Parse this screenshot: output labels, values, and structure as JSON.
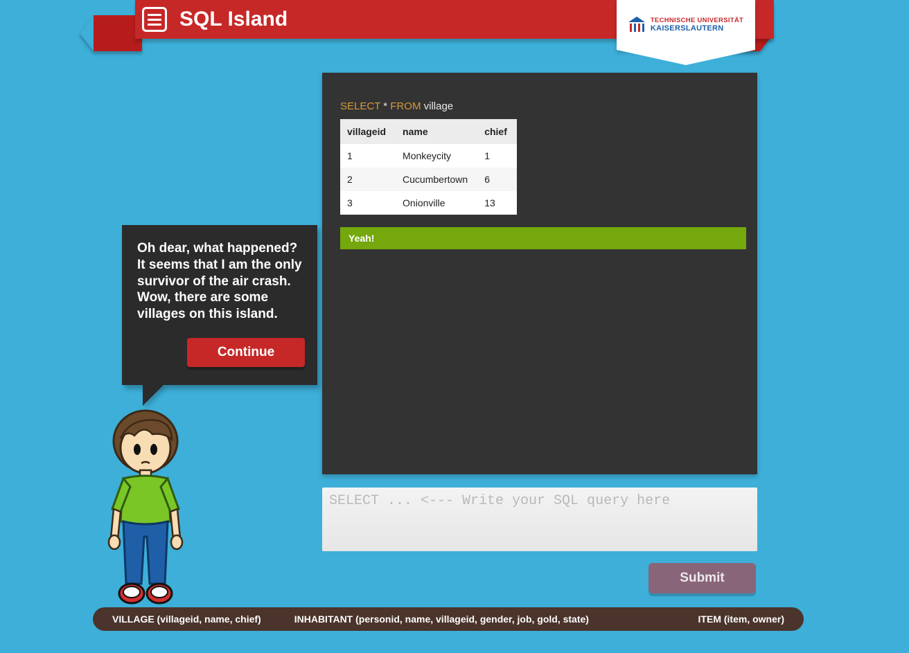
{
  "header": {
    "title": "SQL Island",
    "university_line1": "TECHNISCHE UNIVERSITÄT",
    "university_line2": "KAISERSLAUTERN"
  },
  "speech": {
    "text": "Oh dear, what happened? It seems that I am the only survivor of the air crash. Wow, there are some villages on this island.",
    "continue_label": "Continue"
  },
  "query": {
    "select_kw": "SELECT",
    "star": "*",
    "from_kw": "FROM",
    "table": "village"
  },
  "result_table": {
    "columns": [
      "villageid",
      "name",
      "chief"
    ],
    "rows": [
      {
        "villageid": "1",
        "name": "Monkeycity",
        "chief": "1"
      },
      {
        "villageid": "2",
        "name": "Cucumbertown",
        "chief": "6"
      },
      {
        "villageid": "3",
        "name": "Onionville",
        "chief": "13"
      }
    ]
  },
  "success_message": "Yeah!",
  "sql_input": {
    "placeholder": "SELECT ... <--- Write your SQL query here",
    "value": ""
  },
  "submit_label": "Submit",
  "schema": {
    "village": "VILLAGE (villageid, name, chief)",
    "inhabitant": "INHABITANT (personid, name, villageid, gender, job, gold, state)",
    "item": "ITEM (item, owner)"
  }
}
